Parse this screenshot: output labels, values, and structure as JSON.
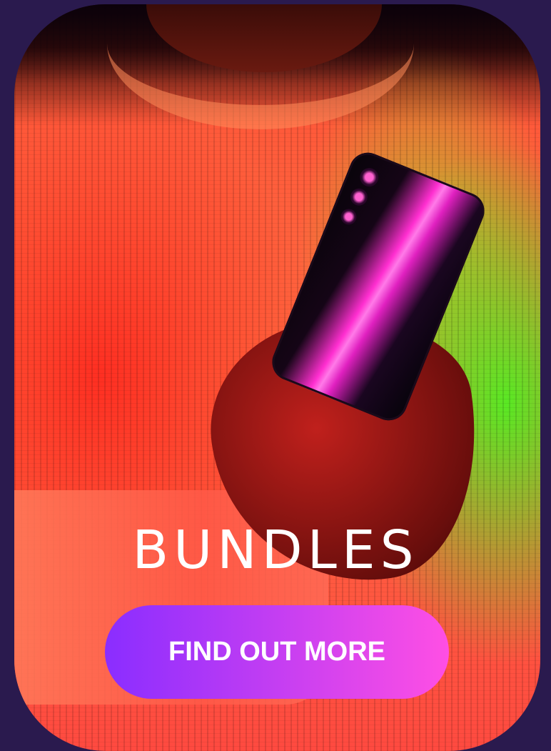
{
  "card": {
    "title": "BUNDLES",
    "cta_label": "FIND OUT MORE",
    "image": "person-holding-phone-photo"
  },
  "colors": {
    "page_background": "#2a1a4e",
    "cta_gradient_start": "#8a2dff",
    "cta_gradient_end": "#ff4fe4",
    "title_color": "#ffffff"
  }
}
